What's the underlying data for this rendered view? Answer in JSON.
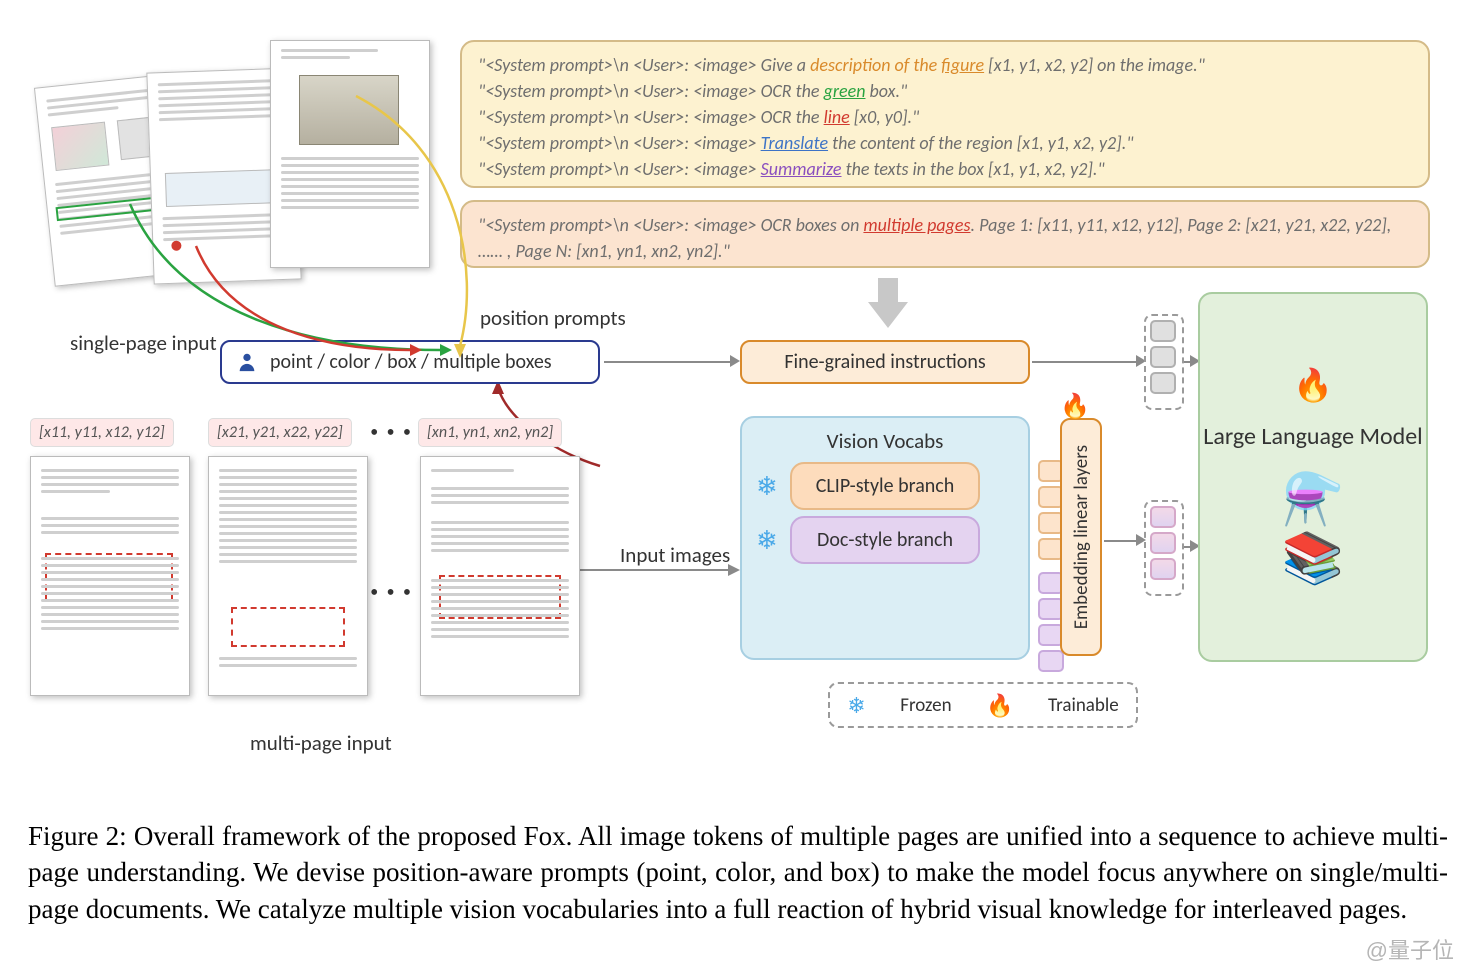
{
  "prompts_single": [
    {
      "pre": "\"<System prompt>\\n <User>: <image> Give a ",
      "kw": "description of the ",
      "kw2": "figure",
      "post": " [x1, y1, x2, y2] on the image.\"",
      "cls": "u-figure"
    },
    {
      "pre": "\"<System prompt>\\n <User>: <image> OCR the ",
      "kw": "",
      "kw2": "green",
      "post": " box.\"",
      "cls": "u-green"
    },
    {
      "pre": "\"<System prompt>\\n <User>: <image> OCR the ",
      "kw": "",
      "kw2": "line",
      "post": " [x0, y0].\"",
      "cls": "u-line"
    },
    {
      "pre": "\"<System prompt>\\n <User>: <image> ",
      "kw": "",
      "kw2": "Translate",
      "post": " the content of the region [x1, y1, x2, y2].\"",
      "cls": "u-trans"
    },
    {
      "pre": "\"<System prompt>\\n <User>: <image> ",
      "kw": "",
      "kw2": "Summarize",
      "post": " the texts in the box [x1, y1, x2, y2].\"",
      "cls": "u-sum"
    }
  ],
  "prompt_multi": {
    "pre": "\"<System prompt>\\n <User>: <image> OCR boxes on ",
    "kw": "multiple pages",
    "post": ". Page 1: [x11, y11, x12, y12], Page 2: [x21, y21, x22, y22], …… , Page N: [xn1, yn1, xn2, yn2].\""
  },
  "labels": {
    "single_page": "single-page input",
    "multi_page": "multi-page input",
    "position_prompts": "position prompts",
    "input_images": "Input images",
    "pos_pill": "point / color / box / multiple boxes",
    "fine_grained": "Fine-grained instructions",
    "vision_vocabs": "Vision Vocabs",
    "clip": "CLIP-style branch",
    "doc": "Doc-style branch",
    "ell": "Embedding linear layers",
    "llm": "Large Language Model",
    "frozen": "Frozen",
    "trainable": "Trainable"
  },
  "coords": [
    "[x11, y11, x12, y12]",
    "[x21, y21, x22, y22]",
    "[xn1, yn1, xn2, yn2]"
  ],
  "caption": "Figure 2: Overall framework of the proposed Fox. All image tokens of multiple pages are unified into a sequence to achieve multi-page understanding. We devise position-aware prompts (point, color, and box) to make the model focus anywhere on single/multi-page documents. We catalyze multiple vision vocabularies into a full reaction of hybrid visual knowledge for interleaved pages.",
  "watermark": "@量子位",
  "icons": {
    "snow": "❄",
    "fire": "🔥",
    "books": "📚",
    "flask": "⚗️",
    "person": "👤"
  }
}
